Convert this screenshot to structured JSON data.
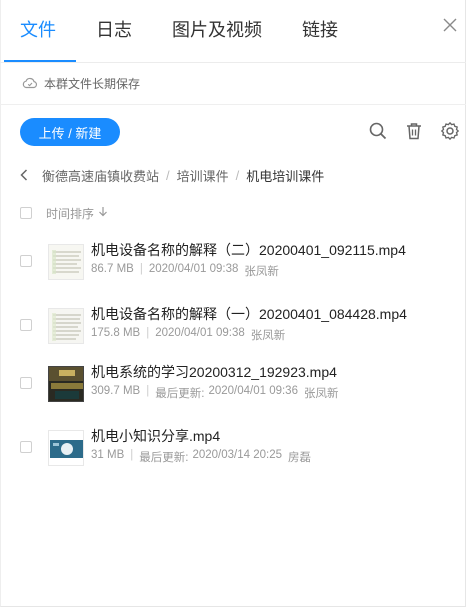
{
  "tabs": [
    {
      "label": "文件",
      "active": true
    },
    {
      "label": "日志",
      "active": false
    },
    {
      "label": "图片及视频",
      "active": false
    },
    {
      "label": "链接",
      "active": false
    }
  ],
  "notice": {
    "text": "本群文件长期保存",
    "icon": "cloud-icon"
  },
  "toolbar": {
    "upload_label": "上传 / 新建",
    "icons": [
      "search-icon",
      "trash-icon",
      "gear-icon"
    ]
  },
  "breadcrumb": {
    "items": [
      "衡德高速庙镇收费站",
      "培训课件",
      "机电培训课件"
    ]
  },
  "sort": {
    "label": "时间排序"
  },
  "files": [
    {
      "name": "机电设备名称的解释（二）20200401_092115.mp4",
      "size": "86.7 MB",
      "date_prefix": "",
      "date": "2020/04/01 09:38",
      "owner": "张凤新"
    },
    {
      "name": "机电设备名称的解释（一）20200401_084428.mp4",
      "size": "175.8 MB",
      "date_prefix": "",
      "date": "2020/04/01 09:38",
      "owner": "张凤新"
    },
    {
      "name": "机电系统的学习20200312_192923.mp4",
      "size": "309.7 MB",
      "date_prefix": "最后更新:",
      "date": "2020/04/01 09:36",
      "owner": "张凤新"
    },
    {
      "name": "机电小知识分享.mp4",
      "size": "31 MB",
      "date_prefix": "最后更新:",
      "date": "2020/03/14 20:25",
      "owner": "房磊"
    }
  ],
  "colors": {
    "accent": "#1a8cff",
    "text": "#333333",
    "muted": "#999999"
  }
}
